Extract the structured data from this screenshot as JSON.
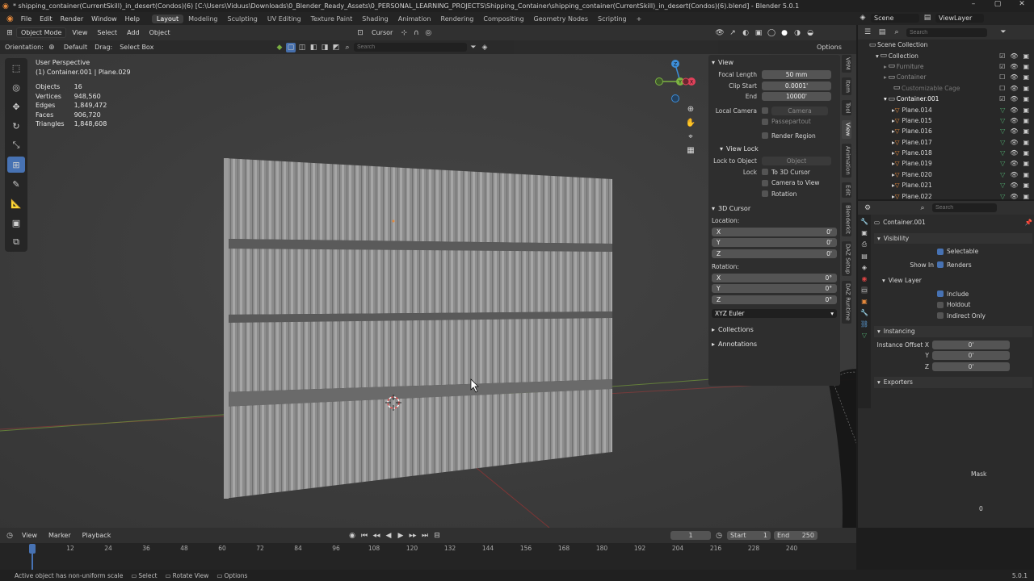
{
  "title_bar": {
    "title": "* shipping_container(CurrentSkill)_in_desert(Condos)(6) [C:\\Users\\Viduus\\Downloads\\0_Blender_Ready_Assets\\0_PERSONAL_LEARNING_PROJECTS\\Shipping_Container\\shipping_container(CurrentSkill)_in_desert(Condos)(6).blend] - Blender 5.0.1"
  },
  "menu": [
    "File",
    "Edit",
    "Render",
    "Window",
    "Help"
  ],
  "workspaces": [
    "Layout",
    "Modeling",
    "Sculpting",
    "UV Editing",
    "Texture Paint",
    "Shading",
    "Animation",
    "Rendering",
    "Compositing",
    "Geometry Nodes",
    "Scripting"
  ],
  "active_workspace": "Layout",
  "scene": {
    "scene_name": "Scene",
    "view_layer": "ViewLayer"
  },
  "viewport_header": {
    "mode": "Object Mode",
    "menus": [
      "View",
      "Select",
      "Add",
      "Object"
    ],
    "transform": "Cursor",
    "options": "Options"
  },
  "tool_header": {
    "orientation_label": "Orientation:",
    "orientation": "Default",
    "drag_label": "Drag:",
    "drag": "Select Box",
    "search_placeholder": "Search"
  },
  "viewport_info": {
    "perspective": "User Perspective",
    "context": "(1) Container.001 | Plane.029",
    "stats": [
      {
        "label": "Objects",
        "value": "16"
      },
      {
        "label": "Vertices",
        "value": "948,560"
      },
      {
        "label": "Edges",
        "value": "1,849,472"
      },
      {
        "label": "Faces",
        "value": "906,720"
      },
      {
        "label": "Triangles",
        "value": "1,848,608"
      }
    ]
  },
  "gizmo": {
    "x": "X",
    "y": "Y",
    "z": "Z"
  },
  "npanel": {
    "view_header": "View",
    "focal_length_label": "Focal Length",
    "focal_length": "50 mm",
    "clip_start_label": "Clip Start",
    "clip_start": "0.0001'",
    "end_label": "End",
    "end": "10000'",
    "local_camera_label": "Local Camera",
    "camera_placeholder": "Camera",
    "passepartout": "Passepartout",
    "render_region": "Render Region",
    "view_lock_header": "View Lock",
    "lock_to_object_label": "Lock to Object",
    "object_placeholder": "Object",
    "lock_label": "Lock",
    "to_3d_cursor": "To 3D Cursor",
    "camera_to_view": "Camera to View",
    "rotation_chk": "Rotation",
    "cursor_header": "3D Cursor",
    "location_label": "Location:",
    "loc": [
      {
        "axis": "X",
        "value": "0'"
      },
      {
        "axis": "Y",
        "value": "0'"
      },
      {
        "axis": "Z",
        "value": "0'"
      }
    ],
    "rotation_label": "Rotation:",
    "rot": [
      {
        "axis": "X",
        "value": "0°"
      },
      {
        "axis": "Y",
        "value": "0°"
      },
      {
        "axis": "Z",
        "value": "0°"
      }
    ],
    "euler": "XYZ Euler",
    "collections": "Collections",
    "annotations": "Annotations"
  },
  "side_tabs": [
    "VRM",
    "Item",
    "Tool",
    "View",
    "Animation",
    "Edit",
    "Blenderkit",
    "DAZ Setup",
    "DAZ Runtime"
  ],
  "active_side_tab": "View",
  "outliner": {
    "search_placeholder": "Search",
    "scene_collection": "Scene Collection",
    "collection": "Collection",
    "furniture": "Furniture",
    "container": "Container",
    "customizable_cage": "Customizable Cage",
    "container001": "Container.001",
    "items": [
      "Plane.014",
      "Plane.015",
      "Plane.016",
      "Plane.017",
      "Plane.018",
      "Plane.019",
      "Plane.020",
      "Plane.021",
      "Plane.022"
    ]
  },
  "properties": {
    "search_placeholder": "Search",
    "object_name": "Container.001",
    "visibility_header": "Visibility",
    "selectable": "Selectable",
    "show_in_label": "Show In",
    "renders": "Renders",
    "view_layer_header": "View Layer",
    "include": "Include",
    "holdout": "Holdout",
    "indirect_only": "Indirect Only",
    "instancing_header": "Instancing",
    "instance_offset_label": "Instance Offset X",
    "y_label": "Y",
    "z_label": "Z",
    "offset": [
      "0'",
      "0'",
      "0'"
    ],
    "exporters_header": "Exporters",
    "mask_label": "Mask",
    "misc_value": "0"
  },
  "timeline": {
    "menus": [
      "View",
      "Marker",
      "Playback"
    ],
    "current_frame": "1",
    "start_label": "Start",
    "start": "1",
    "end_label": "End",
    "end": "250",
    "ticks": [
      "1",
      "12",
      "24",
      "36",
      "48",
      "60",
      "72",
      "84",
      "96",
      "108",
      "120",
      "132",
      "144",
      "156",
      "168",
      "180",
      "192",
      "204",
      "216",
      "228",
      "240"
    ]
  },
  "status_bar": {
    "message": "Active object has non-uniform scale",
    "select": "Select",
    "rotate_view": "Rotate View",
    "options": "Options",
    "version": "5.0.1"
  },
  "colors": {
    "accent": "#4772b3",
    "x_axis": "#e0405a",
    "y_axis": "#7cb342",
    "z_axis": "#3d8ed9",
    "object_orange": "#e4893c"
  }
}
